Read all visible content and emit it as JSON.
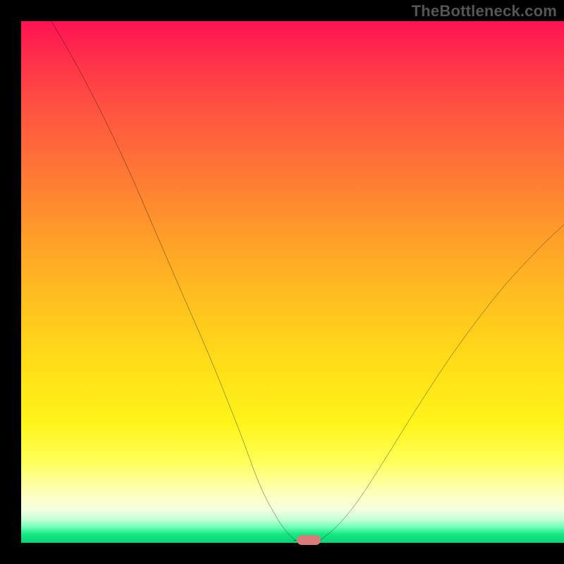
{
  "watermark": "TheBottleneck.com",
  "colors": {
    "gradient_top": "#ff1254",
    "gradient_mid_orange": "#ff8a2e",
    "gradient_yellow": "#ffe81a",
    "gradient_pale": "#ffffc0",
    "gradient_green": "#0ad176",
    "curve_stroke": "#000000",
    "marker_fill": "#d97b7a",
    "frame_bg": "#000000"
  },
  "chart_data": {
    "type": "line",
    "title": "",
    "xlabel": "",
    "ylabel": "",
    "xlim": [
      0,
      100
    ],
    "ylim": [
      0,
      100
    ],
    "series": [
      {
        "name": "left-branch",
        "x": [
          5,
          10,
          15,
          20,
          25,
          30,
          35,
          40,
          44,
          47,
          49,
          50.5
        ],
        "values": [
          101,
          92,
          82,
          71,
          59,
          47,
          35,
          22,
          11,
          5,
          2,
          0.5
        ]
      },
      {
        "name": "valley-floor",
        "x": [
          50.5,
          55
        ],
        "values": [
          0.5,
          0.5
        ]
      },
      {
        "name": "right-branch",
        "x": [
          55,
          58,
          62,
          67,
          73,
          80,
          88,
          95,
          100
        ],
        "values": [
          0.5,
          3,
          8,
          16,
          26,
          37,
          48,
          56,
          61
        ]
      }
    ],
    "marker": {
      "x": 53,
      "y": 0.5
    }
  }
}
